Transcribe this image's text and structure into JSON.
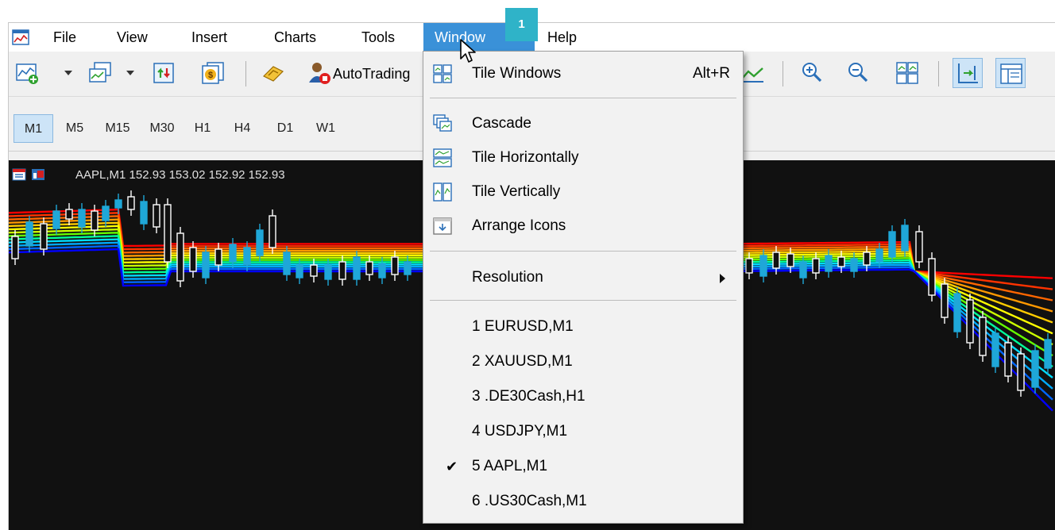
{
  "menubar": {
    "items": [
      {
        "label": "File"
      },
      {
        "label": "View"
      },
      {
        "label": "Insert"
      },
      {
        "label": "Charts"
      },
      {
        "label": "Tools"
      },
      {
        "label": "Window"
      },
      {
        "label": "Help"
      }
    ],
    "active_index": 5
  },
  "toolbar": {
    "autotrading_label": "AutoTrading",
    "icons": [
      "new-chart-icon",
      "profiles-icon",
      "market-watch-icon",
      "data-window-icon",
      "meta-editor-icon",
      "auto-trading-icon",
      "chart-line-icon",
      "zoom-in-icon",
      "zoom-out-icon",
      "tile-windows-icon",
      "chart-shift-icon",
      "auto-scroll-icon"
    ]
  },
  "timeframes": {
    "items": [
      "M1",
      "M5",
      "M15",
      "M30",
      "H1",
      "H4",
      "D1",
      "W1"
    ],
    "active": "M1"
  },
  "chart": {
    "title": "AAPL,M1  152.93 153.02 152.92 152.93",
    "colors": {
      "background": "#111111",
      "bull": "#1fa7d8",
      "bear": "#ffffff"
    }
  },
  "badge": {
    "label": "1"
  },
  "window_menu": {
    "tile_windows": {
      "label": "Tile Windows",
      "shortcut": "Alt+R"
    },
    "cascade": {
      "label": "Cascade"
    },
    "tile_horizontally": {
      "label": "Tile Horizontally"
    },
    "tile_vertically": {
      "label": "Tile Vertically"
    },
    "arrange_icons": {
      "label": "Arrange Icons"
    },
    "resolution": {
      "label": "Resolution"
    },
    "windows": [
      {
        "label": "1 EURUSD,M1",
        "checked": false
      },
      {
        "label": "2 XAUUSD,M1",
        "checked": false
      },
      {
        "label": "3 .DE30Cash,H1",
        "checked": false
      },
      {
        "label": "4 USDJPY,M1",
        "checked": false
      },
      {
        "label": "5 AAPL,M1",
        "checked": true
      },
      {
        "label": "6 .US30Cash,M1",
        "checked": false
      }
    ],
    "check_glyph": "✔"
  }
}
